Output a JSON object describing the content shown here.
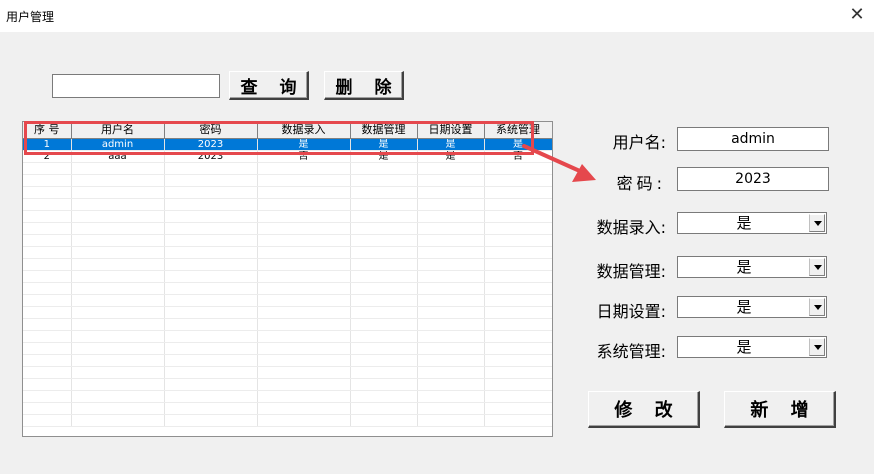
{
  "window": {
    "title": "用户管理",
    "close_glyph": "✕"
  },
  "search": {
    "value": "",
    "placeholder": ""
  },
  "buttons": {
    "query": "查 询",
    "delete": "删 除",
    "modify": "修 改",
    "new": "新 增"
  },
  "grid": {
    "headers": [
      "序 号",
      "用户名",
      "密码",
      "数据录入",
      "数据管理",
      "日期设置",
      "系统管理"
    ],
    "rows": [
      [
        "1",
        "admin",
        "2023",
        "是",
        "是",
        "是",
        "是"
      ],
      [
        "2",
        "aaa",
        "2023",
        "否",
        "是",
        "是",
        "否"
      ]
    ],
    "selected_row": 0,
    "empty_rows": 22
  },
  "form": {
    "username_label": "用户名:",
    "username_value": "admin",
    "password_label": "密码:",
    "password_value": "2023",
    "data_entry_label": "数据录入:",
    "data_entry_value": "是",
    "data_manage_label": "数据管理:",
    "data_manage_value": "是",
    "date_setting_label": "日期设置:",
    "date_setting_value": "是",
    "system_manage_label": "系统管理:",
    "system_manage_value": "是"
  },
  "annotation": {
    "highlight_color": "#e5484d"
  },
  "colors": {
    "selection": "#0078d7",
    "window_bg": "#f0f0f0"
  }
}
